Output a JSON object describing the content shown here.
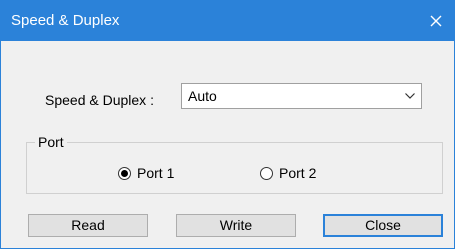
{
  "window": {
    "title": "Speed & Duplex"
  },
  "form": {
    "speed_duplex_label": "Speed & Duplex :",
    "speed_duplex_value": "Auto"
  },
  "port_group": {
    "legend": "Port",
    "options": [
      {
        "label": "Port 1",
        "selected": true
      },
      {
        "label": "Port 2",
        "selected": false
      }
    ]
  },
  "buttons": {
    "read": "Read",
    "write": "Write",
    "close": "Close"
  },
  "colors": {
    "titlebar": "#2b82d9",
    "dialog_bg": "#f0f0f0",
    "button_bg": "#e1e1e1",
    "default_button_border": "#2b82d9"
  },
  "icons": {
    "close": "close-icon",
    "dropdown": "chevron-down-icon"
  }
}
